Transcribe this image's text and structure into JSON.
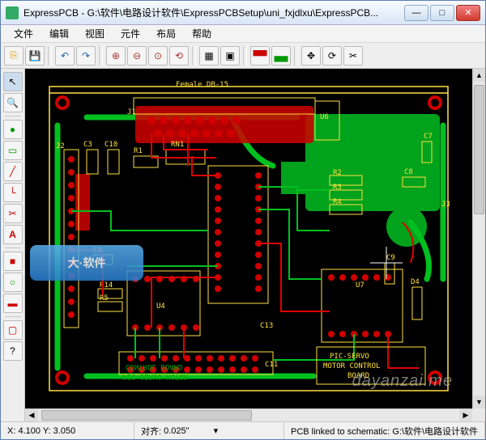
{
  "window": {
    "title": "ExpressPCB - G:\\软件\\电路设计软件\\ExpressPCBSetup\\uni_fxjdlxu\\ExpressPCB..."
  },
  "menu": {
    "items": [
      "文件",
      "编辑",
      "视图",
      "元件",
      "布局",
      "帮助"
    ]
  },
  "status": {
    "coords": "X: 4.100    Y: 3.050",
    "snap_label": "对齐:",
    "snap_value": "0.025\"",
    "message": "PCB linked to schematic:  G:\\软件\\电路设计软件"
  },
  "pcb": {
    "connector_label": "Female DB-15",
    "board_text1": "PIC-SERVO",
    "board_text2": "MOTOR CONTROL",
    "board_text3": "BOARD",
    "mirror_text1": "PIC-SERVO MOTOR",
    "mirror_text2": "CONTROL BOARD",
    "refs": {
      "j1": "J1",
      "j2": "J2",
      "j3": "J3",
      "c3": "C3",
      "c4": "C4",
      "c7": "C7",
      "c8": "C8",
      "c9": "C9",
      "c10": "C10",
      "c11": "C11",
      "c13": "C13",
      "r1": "R1",
      "r2": "R2",
      "r3": "R3",
      "r4": "R4",
      "r5": "R5",
      "rn1": "RN1",
      "u4": "U4",
      "u6": "U6",
      "u7": "U7",
      "d4": "D4"
    }
  },
  "watermark": "dayanzai.me"
}
